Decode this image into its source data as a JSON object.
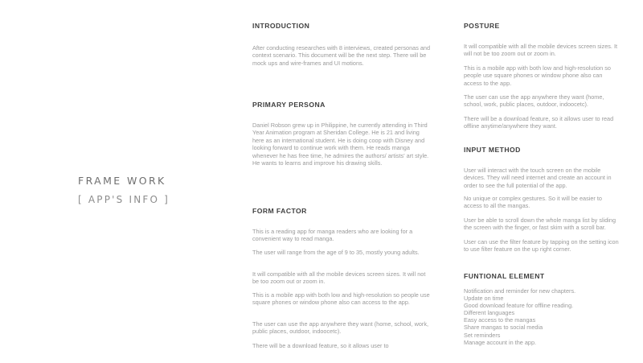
{
  "title": {
    "main": "FRAME WORK",
    "sub": "[ APP'S INFO ]"
  },
  "introduction": {
    "heading": "INTRODUCTION",
    "text": "After conducting researches with 8 interviews, created personas and context scenario. This document will be the next step. There will be mock ups and wire-frames and UI motions."
  },
  "primary_persona": {
    "heading": "PRIMARY PERSONA",
    "text": "Daniel Robson grew up in Philippine,  he currently attending in Third Year Animation program at Sheridan College. He is 21 and living here as an international student. He is doing coop with Disney and looking forward to continue work with them. He reads manga whenever he has free time, he admires the authors/ artists' art style. He wants to learns and improve his drawing skills."
  },
  "form_factor": {
    "heading": "FORM FACTOR",
    "paragraphs": [
      "This is a reading app for manga readers who are looking for a convenient way to read manga.",
      "The user will range from the age of 9 to 35, mostly young adults.",
      "It will compatible with all the mobile devices screen sizes. It will not be too zoom out or zoom in.",
      "This is a mobile app with both low and high-resolution so people use square phones or window phone also can access to the app.",
      "The user can use the app anywhere they want (home, school, work, public places, outdoor, indoocetc).",
      "There will be a download feature, so it allows user to"
    ]
  },
  "posture": {
    "heading": "POSTURE",
    "paragraphs": [
      "It will compatible with all the mobile devices screen sizes. It will not be too zoom out or zoom in.",
      "This is a mobile app with both low and high-resolution so people use square phones or window phone also can access to the app.",
      "The user can use the app anywhere they want (home, school, work, public places, outdoor, indoocetc).",
      "There will be a download feature, so it allows user to read offline anytime/anywhere they want."
    ]
  },
  "input_method": {
    "heading": "INPUT METHOD",
    "paragraphs": [
      "User will interact with the touch screen on the mobile devices. They will need internet and create an account in order to see the full potential of the app.",
      "No unique or complex gestures. So it will be easier to access to all the mangas.",
      "User be able to scroll down the whole manga list by sliding the screen with the finger, or fast skim with a scroll bar.",
      "User can use the filter feature by tapping on the setting icon to use filter feature on the up right corner."
    ]
  },
  "functional_element": {
    "heading": "FUNTIONAL ELEMENT",
    "items": [
      "Notification and reminder for new chapters.",
      "Update on time",
      "Good download feature for offline reading.",
      "Different languages",
      "Easy access to the mangas",
      "Share mangas to social media",
      "Set reminders",
      "Manage account in the app."
    ]
  }
}
